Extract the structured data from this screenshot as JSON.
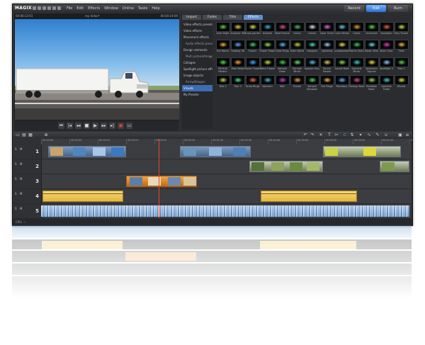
{
  "app": {
    "logo": "MAGIX",
    "menu": [
      "File",
      "Edit",
      "Effects",
      "Window",
      "Online",
      "Tasks",
      "Help"
    ],
    "modes": [
      {
        "label": "Record",
        "active": false
      },
      {
        "label": "Edit",
        "active": true
      },
      {
        "label": "Burn",
        "active": false
      }
    ]
  },
  "preview": {
    "timecode_left": "00:00:13:01",
    "title": "my Video*",
    "timecode_right": "00:00:19:09"
  },
  "pool": {
    "tabs": [
      {
        "label": "Import",
        "active": false
      },
      {
        "label": "Fades",
        "active": false
      },
      {
        "label": "Title",
        "active": false
      },
      {
        "label": "Effects",
        "active": true
      }
    ],
    "categories": [
      {
        "label": "Video effects presets",
        "sub": false,
        "selected": false
      },
      {
        "label": "Video effects",
        "sub": false,
        "selected": false
      },
      {
        "label": "Movement effects",
        "sub": false,
        "selected": false
      },
      {
        "label": "Audio effects presets",
        "sub": true,
        "selected": false
      },
      {
        "label": "Design elements",
        "sub": false,
        "selected": false
      },
      {
        "label": "Multi picture/Image",
        "sub": true,
        "selected": false
      },
      {
        "label": "Collages",
        "sub": false,
        "selected": false
      },
      {
        "label": "Spotlight picture effs",
        "sub": false,
        "selected": false
      },
      {
        "label": "Image objects",
        "sub": false,
        "selected": false
      },
      {
        "label": "Arrow/Shapes",
        "sub": true,
        "selected": false
      },
      {
        "label": "Visuals",
        "sub": false,
        "selected": true
      },
      {
        "label": "My Presets",
        "sub": false,
        "selected": false
      }
    ],
    "effects": [
      {
        "label": "Alien flight",
        "color": "#66d23a"
      },
      {
        "label": "Analyzer 3D",
        "color": "#e8c94a"
      },
      {
        "label": "Arrow garden",
        "color": "#d7e24a"
      },
      {
        "label": "Artwork",
        "color": "#3fb4e6"
      },
      {
        "label": "Beat Fractal",
        "color": "#e54c8a"
      },
      {
        "label": "Canon",
        "color": "#48c06a"
      },
      {
        "label": "Cloudy",
        "color": "#e0e0e0"
      },
      {
        "label": "Color Circle",
        "color": "#e36bd9"
      },
      {
        "label": "Color Wheel",
        "color": "#5bd0e6"
      },
      {
        "label": "Comic",
        "color": "#f0a030"
      },
      {
        "label": "Confusion",
        "color": "#62d84a"
      },
      {
        "label": "Explosion",
        "color": "#f06040"
      },
      {
        "label": "Fairy Flower",
        "color": "#c8e040"
      },
      {
        "label": "Fire Works",
        "color": "#ffb030"
      },
      {
        "label": "Floating 3D",
        "color": "#60a8ff"
      },
      {
        "label": "Flower",
        "color": "#44d070"
      },
      {
        "label": "Flower Power",
        "color": "#8ee24a"
      },
      {
        "label": "Glow Rings",
        "color": "#50c0ff"
      },
      {
        "label": "Hello World",
        "color": "#d0d040"
      },
      {
        "label": "Lissajous",
        "color": "#40e0b0"
      },
      {
        "label": "Lightning",
        "color": "#a0c8ff"
      },
      {
        "label": "Loudspeaker",
        "color": "#e8e050"
      },
      {
        "label": "Matrix Stars",
        "color": "#40d060"
      },
      {
        "label": "Morph Wire",
        "color": "#60e0e0"
      },
      {
        "label": "Neon Color",
        "color": "#e040c0"
      },
      {
        "label": "Orbit",
        "color": "#f0c040"
      },
      {
        "label": "Particle Pattern",
        "color": "#50e050"
      },
      {
        "label": "Pixel Walls",
        "color": "#ffa040"
      },
      {
        "label": "Planet Flower",
        "color": "#40b0ff"
      },
      {
        "label": "Retro Flower",
        "color": "#d0e040"
      },
      {
        "label": "Sample Clean",
        "color": "#48d058"
      },
      {
        "label": "Sample Mirror",
        "color": "#70e070"
      },
      {
        "label": "Sample Only",
        "color": "#60c0f0"
      },
      {
        "label": "Sound Smoke",
        "color": "#e0d060"
      },
      {
        "label": "Sound Vista",
        "color": "#80e060"
      },
      {
        "label": "Spectral Mirror",
        "color": "#40d0d0"
      },
      {
        "label": "Spectrum Figures",
        "color": "#f0e040"
      },
      {
        "label": "Starflight 3",
        "color": "#90d0ff"
      },
      {
        "label": "Tree 1",
        "color": "#60d050"
      },
      {
        "label": "Tree 2",
        "color": "#c0e050"
      },
      {
        "label": "Tree 3",
        "color": "#50e090"
      },
      {
        "label": "Turbo Rings",
        "color": "#f07040"
      },
      {
        "label": "Voiceam",
        "color": "#40c0e0"
      },
      {
        "label": "Well",
        "color": "#d040d0"
      },
      {
        "label": "Fractal",
        "color": "#f0a050"
      },
      {
        "label": "Sample Rainbow",
        "color": "#50e060"
      },
      {
        "label": "Fire Rings",
        "color": "#ffb040"
      },
      {
        "label": "Planetary",
        "color": "#60b0ff"
      },
      {
        "label": "Pulsing Heart",
        "color": "#e05080"
      },
      {
        "label": "Rainbow Bach",
        "color": "#a0e050"
      },
      {
        "label": "Spectral Fonts",
        "color": "#50d0c0"
      },
      {
        "label": "Wizard",
        "color": "#e0e040"
      }
    ]
  },
  "timeline": {
    "ruler_labels": [
      "00:00:00",
      "00:00:05",
      "00:00:10",
      "00:00:15",
      "00:00:20",
      "00:00:25",
      "00:00:30",
      "00:00:35",
      "00:00:40",
      "00:00:45",
      "00:00:50",
      "00:00:55",
      "00:01:00",
      "00:01:05"
    ],
    "marker_label": "00:00:13:01",
    "tracks": [
      {
        "number": "1",
        "solo": "S",
        "mute": "M"
      },
      {
        "number": "2",
        "solo": "S",
        "mute": "M"
      },
      {
        "number": "3",
        "solo": "S",
        "mute": "M"
      },
      {
        "number": "4",
        "solo": "S",
        "mute": "M"
      },
      {
        "number": "5",
        "solo": "S",
        "mute": "M"
      }
    ]
  },
  "status": {
    "text": "CPU: —"
  }
}
